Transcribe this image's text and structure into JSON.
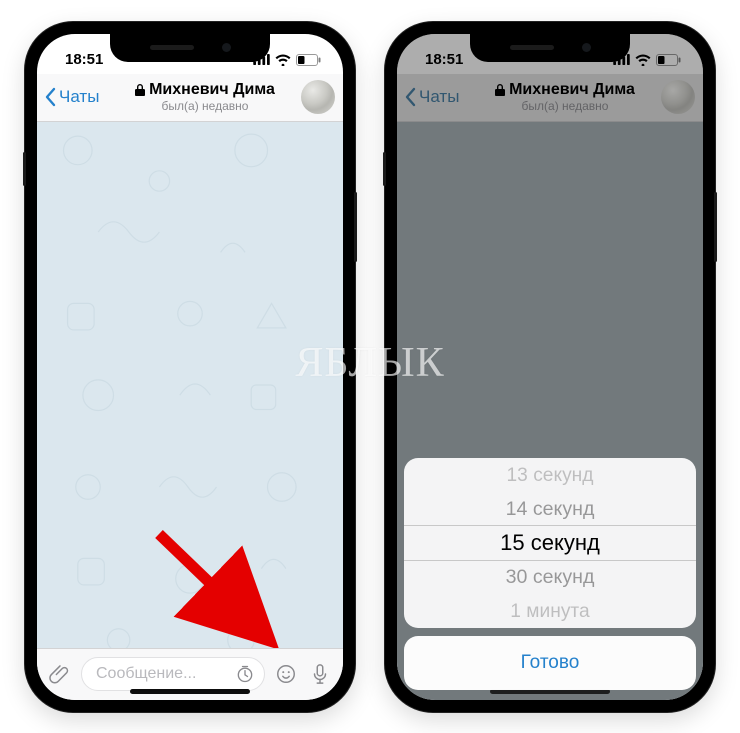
{
  "status": {
    "time": "18:51"
  },
  "nav": {
    "back_label": "Чаты",
    "title": "Михневич Дима",
    "subtitle": "был(а) недавно"
  },
  "compose": {
    "placeholder": "Сообщение..."
  },
  "picker": {
    "options": [
      "13 секунд",
      "14 секунд",
      "15 секунд",
      "30 секунд",
      "1 минута"
    ],
    "done_label": "Готово"
  },
  "watermark": "ЯБЛЫК"
}
